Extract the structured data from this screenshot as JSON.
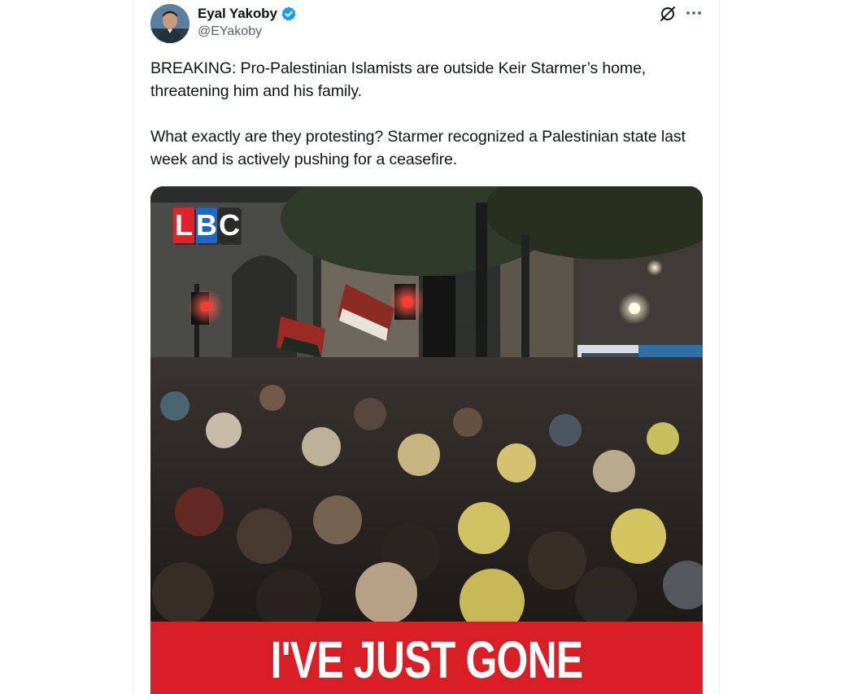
{
  "author": {
    "display_name": "Eyal Yakoby",
    "handle": "@EYakoby",
    "verified": true
  },
  "tweet": {
    "text": "BREAKING: Pro-Palestinian Islamists are outside Keir Starmer’s home, threatening him and his family.\n\nWhat exactly are they protesting? Starmer recognized a Palestinian state last week and is actively pushing for a ceasefire."
  },
  "media": {
    "logo_letters": [
      "L",
      "B",
      "C"
    ],
    "caption": "I'VE JUST GONE"
  },
  "icons": {
    "verified": "verified-badge-icon",
    "grok": "grok-icon",
    "more": "more-options-icon"
  },
  "colors": {
    "text_primary": "#0f1419",
    "text_secondary": "#536471",
    "verified_blue": "#1d9bf0",
    "caption_red": "#d91f26",
    "lbc_red": "#e0232b",
    "lbc_blue": "#1e66c9",
    "lbc_dark": "#2b2b2b"
  }
}
